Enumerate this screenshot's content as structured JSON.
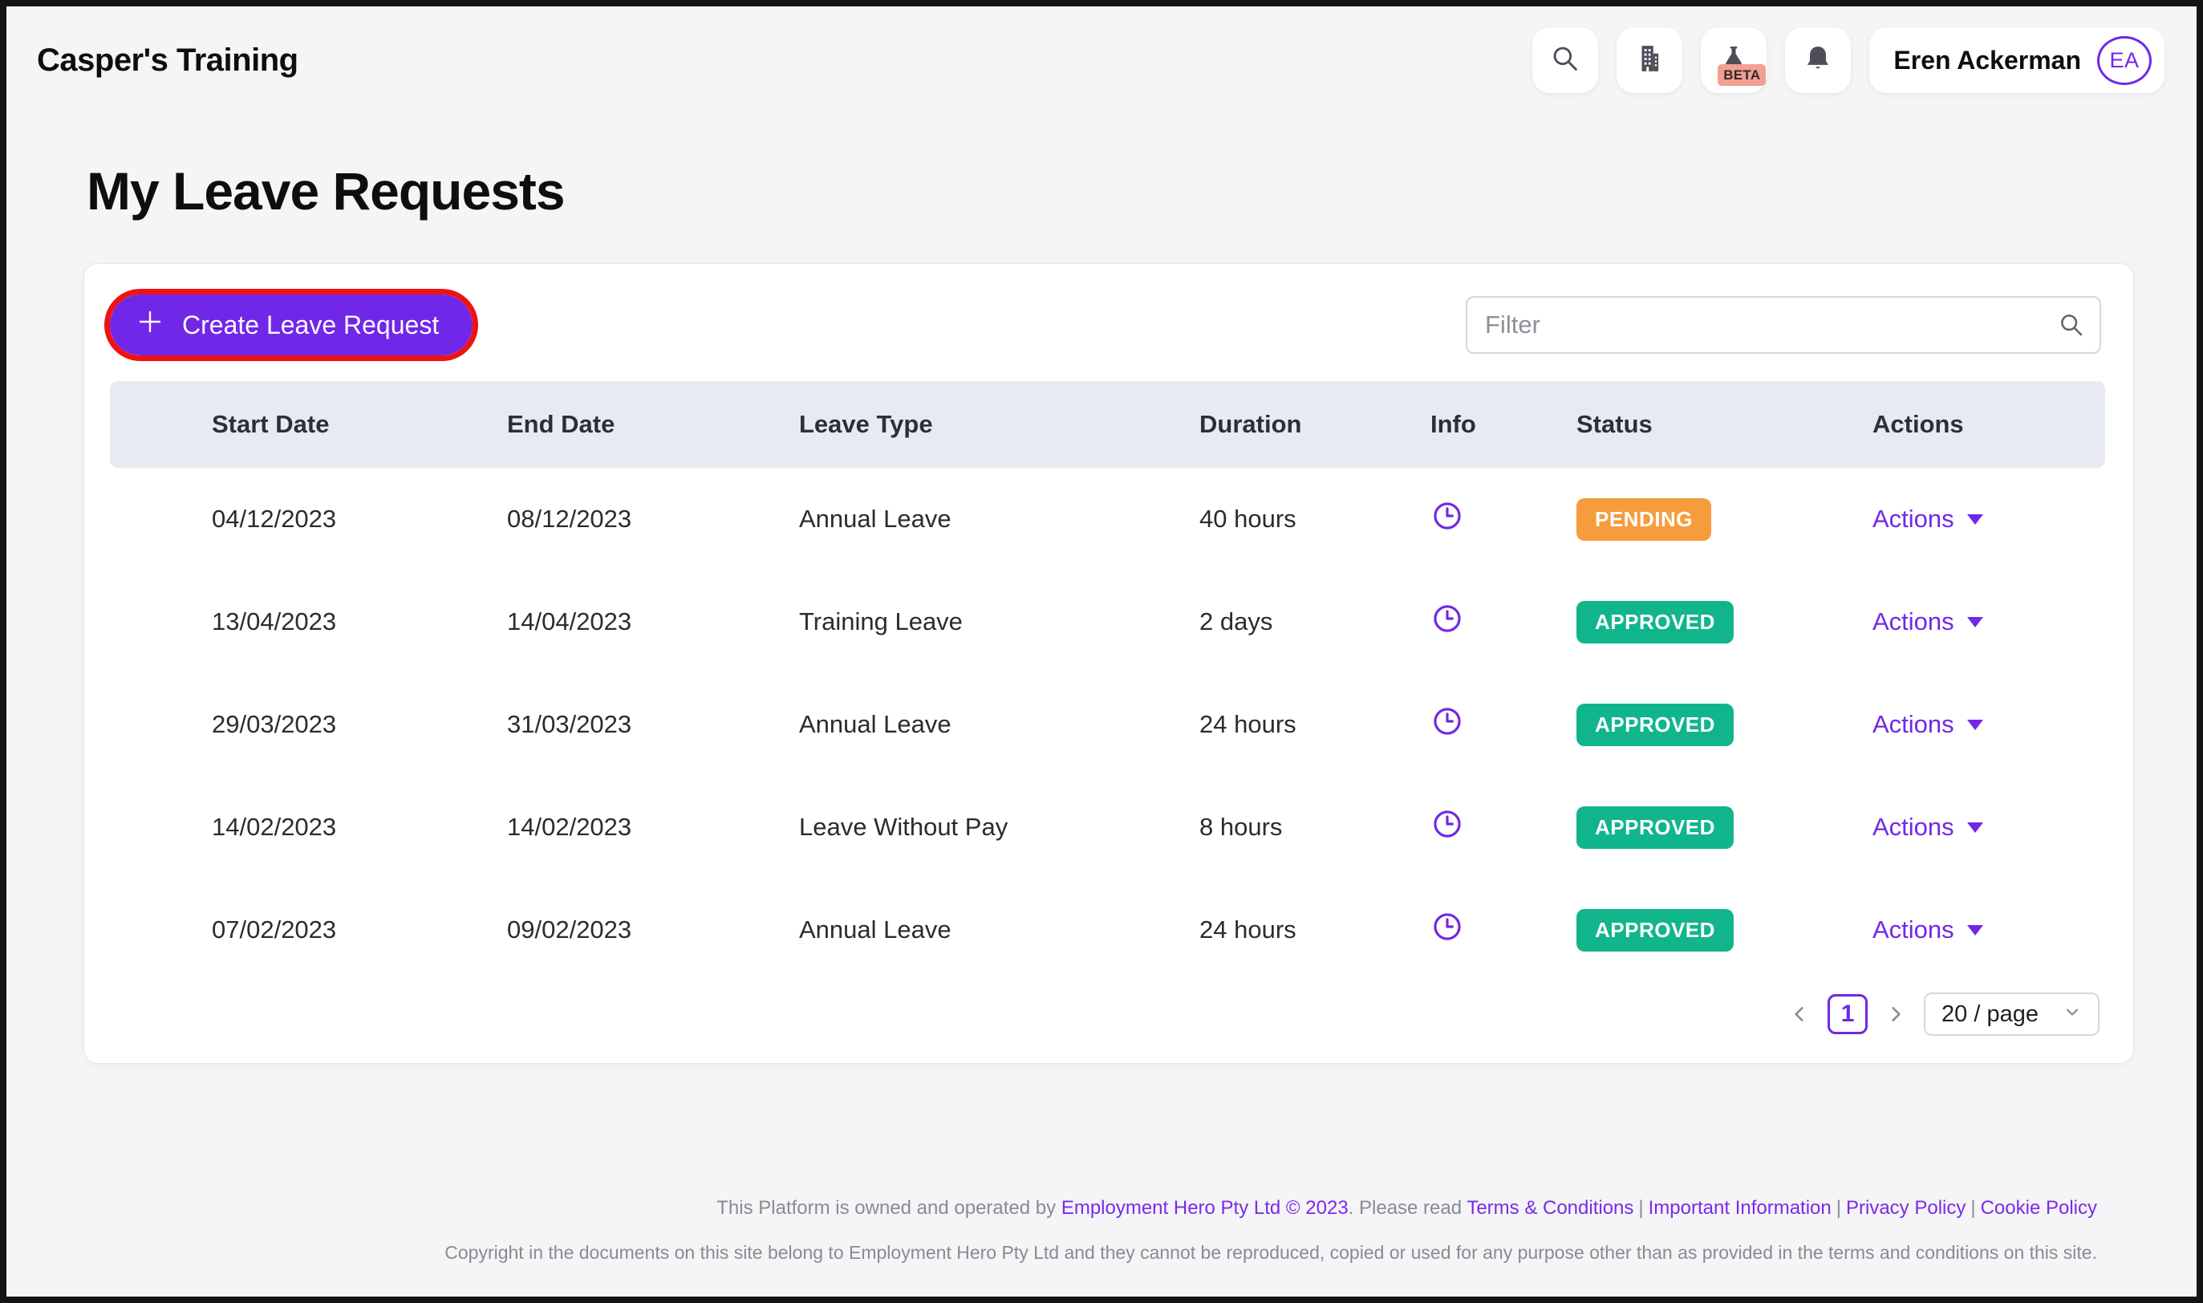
{
  "colors": {
    "accent_purple": "#7127E8",
    "highlight_red": "#EE1212",
    "status_pending": "#F69C3C",
    "status_approved": "#11B58C",
    "beta_badge_bg": "#F2A091",
    "table_header_bg": "#E7EAF0",
    "page_bg": "#F5F4F6"
  },
  "topbar": {
    "brand": "Casper's Training",
    "beta_label": "BETA",
    "user": {
      "name": "Eren Ackerman",
      "initials": "EA"
    }
  },
  "page": {
    "title": "My Leave Requests"
  },
  "toolbar": {
    "create_button_label": "Create Leave Request",
    "filter_placeholder": "Filter"
  },
  "table": {
    "columns": [
      "Start Date",
      "End Date",
      "Leave Type",
      "Duration",
      "Info",
      "Status",
      "Actions"
    ],
    "rows": [
      {
        "start_date": "04/12/2023",
        "end_date": "08/12/2023",
        "leave_type": "Annual Leave",
        "duration": "40 hours",
        "status": "PENDING",
        "actions_label": "Actions"
      },
      {
        "start_date": "13/04/2023",
        "end_date": "14/04/2023",
        "leave_type": "Training Leave",
        "duration": "2 days",
        "status": "APPROVED",
        "actions_label": "Actions"
      },
      {
        "start_date": "29/03/2023",
        "end_date": "31/03/2023",
        "leave_type": "Annual Leave",
        "duration": "24 hours",
        "status": "APPROVED",
        "actions_label": "Actions"
      },
      {
        "start_date": "14/02/2023",
        "end_date": "14/02/2023",
        "leave_type": "Leave Without Pay",
        "duration": "8 hours",
        "status": "APPROVED",
        "actions_label": "Actions"
      },
      {
        "start_date": "07/02/2023",
        "end_date": "09/02/2023",
        "leave_type": "Annual Leave",
        "duration": "24 hours",
        "status": "APPROVED",
        "actions_label": "Actions"
      }
    ]
  },
  "pagination": {
    "current_page": "1",
    "page_size_label": "20 / page"
  },
  "footer": {
    "line1": {
      "prefix": "This Platform is owned and operated by ",
      "company_link": "Employment Hero Pty Ltd © 2023",
      "middle": ". Please read ",
      "links": [
        "Terms & Conditions",
        "Important Information",
        "Privacy Policy",
        "Cookie Policy"
      ],
      "separator": "|"
    },
    "line2": "Copyright in the documents on this site belong to Employment Hero Pty Ltd and they cannot be reproduced, copied or used for any purpose other than as provided in the terms and conditions on this site."
  }
}
